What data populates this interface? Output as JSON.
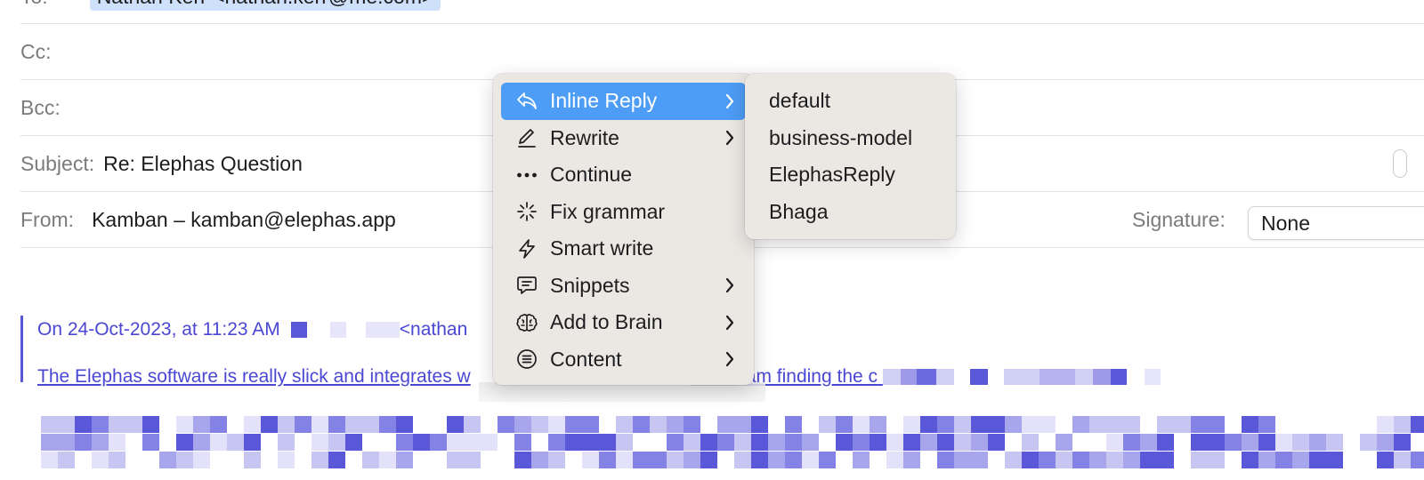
{
  "header": {
    "to_label": "To:",
    "to_value": "Nathan Kerr <nathan.kerr@me.com>",
    "cc_label": "Cc:",
    "bcc_label": "Bcc:",
    "subject_label": "Subject:",
    "subject_value": "Re: Elephas Question",
    "from_label": "From:",
    "from_value": "Kamban – kamban@elephas.app",
    "signature_label": "Signature:",
    "signature_value": "None"
  },
  "quote": {
    "line1_prefix": "On 24-Oct-2023, at 11:23 AM",
    "line1_suffix": "<nathan",
    "line2_start": "The Elephas software is really slick and integrates w",
    "line2_end": "ever. I am finding the c"
  },
  "context_menu": {
    "items": [
      {
        "label": "Inline Reply",
        "icon": "reply-icon",
        "has_submenu": true,
        "active": true
      },
      {
        "label": "Rewrite",
        "icon": "pencil-icon",
        "has_submenu": true
      },
      {
        "label": "Continue",
        "icon": "ellipsis-icon",
        "has_submenu": false
      },
      {
        "label": "Fix grammar",
        "icon": "sparkle-icon",
        "has_submenu": false
      },
      {
        "label": "Smart write",
        "icon": "bolt-icon",
        "has_submenu": false
      },
      {
        "label": "Snippets",
        "icon": "speech-bubble-icon",
        "has_submenu": true
      },
      {
        "label": "Add to Brain",
        "icon": "brain-icon",
        "has_submenu": true
      },
      {
        "label": "Content",
        "icon": "list-circle-icon",
        "has_submenu": true
      }
    ]
  },
  "submenu": {
    "items": [
      "default",
      "business-model",
      "ElephasReply",
      "Bhaga"
    ]
  },
  "colors": {
    "accent": "#4d9cf6",
    "quote": "#4a47d5",
    "menu_bg": "#ebe8e4",
    "to_chip": "#cfe0fb"
  }
}
